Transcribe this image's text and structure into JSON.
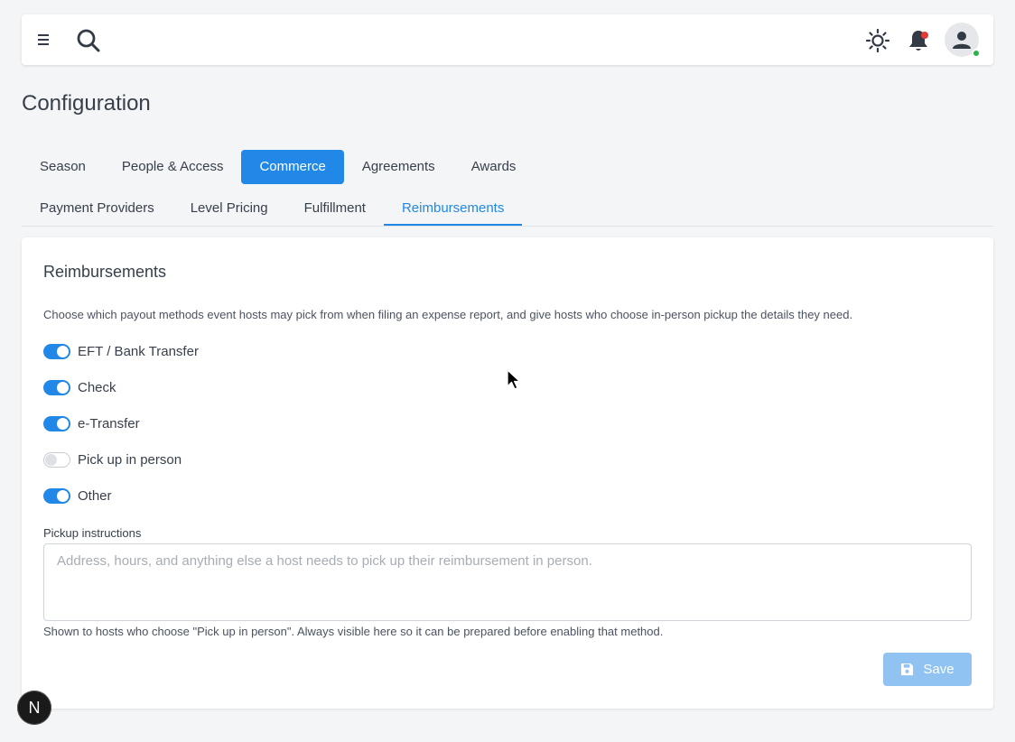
{
  "header": {
    "menu_icon": "menu-icon",
    "search_icon": "search-icon",
    "theme_icon": "sun-icon",
    "notification_icon": "bell-icon",
    "avatar_icon": "user-icon"
  },
  "page": {
    "title": "Configuration"
  },
  "main_tabs": [
    {
      "label": "Season",
      "active": false
    },
    {
      "label": "People & Access",
      "active": false
    },
    {
      "label": "Commerce",
      "active": true
    },
    {
      "label": "Agreements",
      "active": false
    },
    {
      "label": "Awards",
      "active": false
    }
  ],
  "sub_tabs": [
    {
      "label": "Payment Providers",
      "active": false
    },
    {
      "label": "Level Pricing",
      "active": false
    },
    {
      "label": "Fulfillment",
      "active": false
    },
    {
      "label": "Reimbursements",
      "active": true
    }
  ],
  "card": {
    "title": "Reimbursements",
    "description": "Choose which payout methods event hosts may pick from when filing an expense report, and give hosts who choose in-person pickup the details they need.",
    "methods": [
      {
        "label": "EFT / Bank Transfer",
        "enabled": true
      },
      {
        "label": "Check",
        "enabled": true
      },
      {
        "label": "e-Transfer",
        "enabled": true
      },
      {
        "label": "Pick up in person",
        "enabled": false
      },
      {
        "label": "Other",
        "enabled": true
      }
    ],
    "pickup_label": "Pickup instructions",
    "pickup_value": "",
    "pickup_placeholder": "Address, hours, and anything else a host needs to pick up their reimbursement in person.",
    "pickup_help": "Shown to hosts who choose \"Pick up in person\". Always visible here so it can be prepared before enabling that method.",
    "save_label": "Save"
  },
  "badge": {
    "label": "N"
  },
  "colors": {
    "accent": "#2188e8",
    "save_disabled": "#90c3f2",
    "notification_dot": "#e53935",
    "online": "#2bb24c"
  }
}
